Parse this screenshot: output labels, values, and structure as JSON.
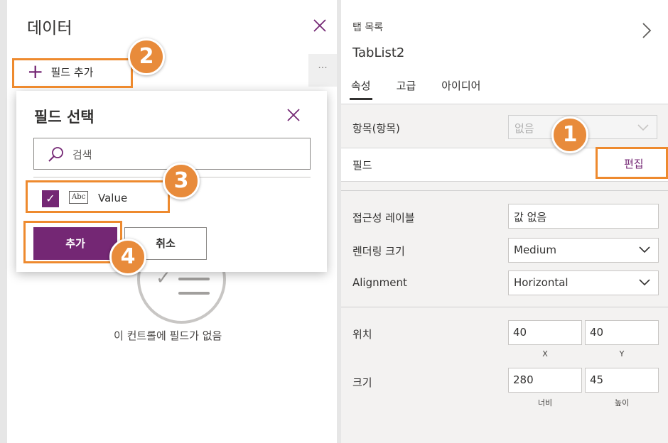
{
  "data_panel": {
    "title": "데이터",
    "close_icon": "close-icon",
    "add_field_label": "필드 추가",
    "more_label": "···",
    "empty_message": "이 컨트롤에 필드가 없음"
  },
  "field_picker": {
    "title": "필드 선택",
    "search_placeholder": "검색",
    "field_type_badge": "Abc",
    "field_name": "Value",
    "field_checked": true,
    "add_button": "추가",
    "cancel_button": "취소"
  },
  "properties": {
    "control_type": "탭 목록",
    "control_name": "TabList2",
    "tabs": [
      {
        "label": "속성",
        "active": true
      },
      {
        "label": "고급",
        "active": false
      },
      {
        "label": "아이디어",
        "active": false
      }
    ],
    "items_label": "항목(항목)",
    "items_value": "없음",
    "fields_label": "필드",
    "edit_link": "편집",
    "accessible_label": "접근성 레이블",
    "accessible_value": "값 없음",
    "render_size_label": "렌더링 크기",
    "render_size_value": "Medium",
    "alignment_label": "Alignment",
    "alignment_value": "Horizontal",
    "position_label": "위치",
    "x_value": "40",
    "y_value": "40",
    "x_sub": "X",
    "y_sub": "Y",
    "size_label": "크기",
    "width_value": "280",
    "height_value": "45",
    "width_sub": "너비",
    "height_sub": "높이"
  },
  "callouts": [
    "1",
    "2",
    "3",
    "4"
  ],
  "colors": {
    "accent": "#742774",
    "callout": "#ee8a2e"
  }
}
